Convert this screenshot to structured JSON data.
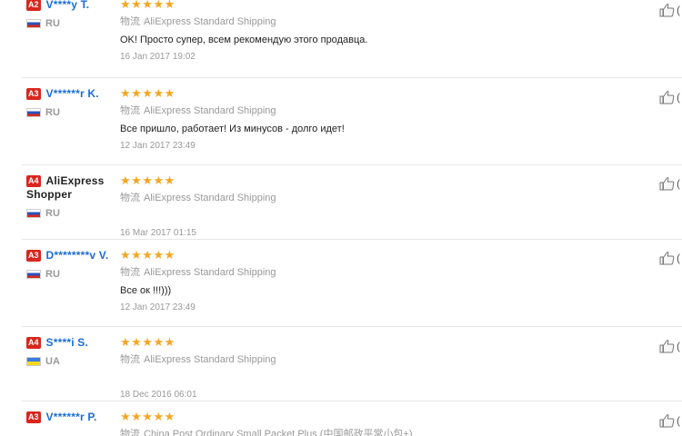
{
  "reviews": [
    {
      "level": "A2",
      "user": "V****y T.",
      "country": "RU",
      "stars": "★★★★★",
      "ship_zh": "物流",
      "ship": "AliExpress Standard Shipping",
      "text": "OK! Просто супер, всем рекомендую этого продавца.",
      "date": "16 Jan 2017 19:02"
    },
    {
      "level": "A3",
      "user": "V******r K.",
      "country": "RU",
      "stars": "★★★★★",
      "ship_zh": "物流",
      "ship": "AliExpress Standard Shipping",
      "text": "Все пришло, работает! Из минусов - долго идет!",
      "date": "12 Jan 2017 23:49"
    },
    {
      "level": "A4",
      "user": "AliExpress Shopper",
      "country": "RU",
      "stars": "★★★★★",
      "ship_zh": "物流",
      "ship": "AliExpress Standard Shipping",
      "text": "",
      "date": "16 Mar 2017 01:15"
    },
    {
      "level": "A3",
      "user": "D********v V.",
      "country": "RU",
      "stars": "★★★★★",
      "ship_zh": "物流",
      "ship": "AliExpress Standard Shipping",
      "text": "Все ок !!!)))",
      "date": "12 Jan 2017 23:49"
    },
    {
      "level": "A4",
      "user": "S****i S.",
      "country": "UA",
      "stars": "★★★★★",
      "ship_zh": "物流",
      "ship": "AliExpress Standard Shipping",
      "text": "",
      "date": "18 Dec 2016 06:01"
    },
    {
      "level": "A3",
      "user": "V******r P.",
      "country": "",
      "stars": "★★★★★",
      "ship_zh": "物流",
      "ship": "China Post Ordinary Small Packet Plus (中国邮政平常小包+)",
      "text": "",
      "date": ""
    }
  ],
  "like_label": "(",
  "icons": {
    "like": "thumbs-up-icon",
    "star": "star-icon",
    "flag": "country-flag-icon"
  },
  "colors": {
    "stars": "#f5a623",
    "username": "#1a6dd6",
    "level_badge": "#d9261c"
  }
}
